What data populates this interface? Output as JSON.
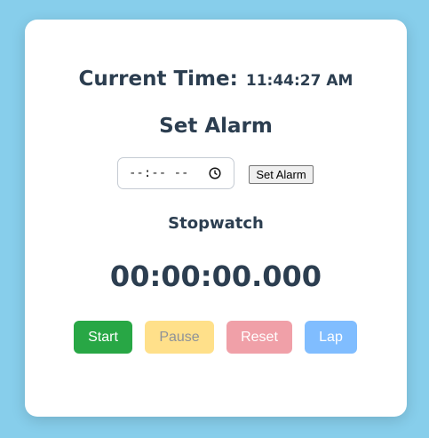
{
  "clock": {
    "label": "Current Time:",
    "value": "11:44:27 AM"
  },
  "alarm": {
    "title": "Set Alarm",
    "time_input_display": "--:-- --",
    "set_button_label": "Set Alarm",
    "icon": "clock-icon"
  },
  "stopwatch": {
    "title": "Stopwatch",
    "display": "00:00:00.000",
    "buttons": {
      "start": "Start",
      "pause": "Pause",
      "reset": "Reset",
      "lap": "Lap"
    }
  },
  "colors": {
    "background": "#87ceeb",
    "text": "#2c3e50",
    "start": "#28a745",
    "pause": "#ffe08a",
    "reset": "#f0a0a8",
    "lap": "#80bdff"
  }
}
